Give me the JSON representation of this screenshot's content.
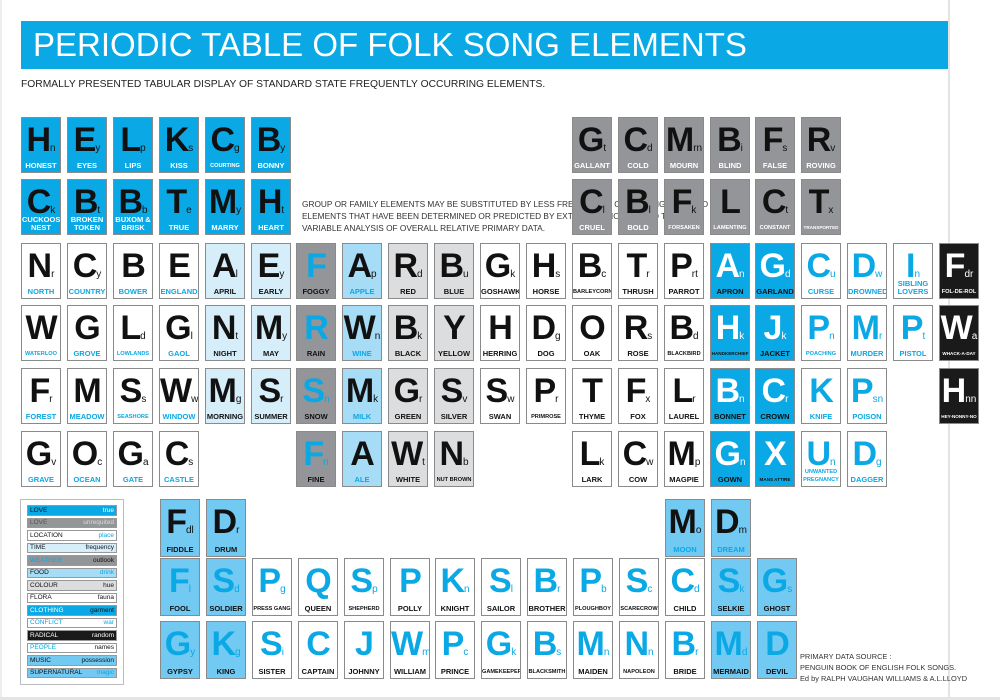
{
  "header": {
    "title": "PERIODIC TABLE OF FOLK SONG ELEMENTS",
    "subtitle": "FORMALLY PRESENTED TABULAR DISPLAY OF STANDARD STATE FREQUENTLY OCCURRING ELEMENTS."
  },
  "note": "GROUP OR FAMILY ELEMENTS MAY BE SUBSTITUTED BY LESS FREQUENTLY OCCURRING ISOLATED ELEMENTS THAT HAVE BEEN DETERMINED OR PREDICTED BY EXTRAPOLATION DUE TO THE VARIABLE ANALYSIS OF OVERALL RELATIVE PRIMARY DATA.",
  "source": {
    "line1": "PRIMARY DATA SOURCE :",
    "line2": "PENGUIN BOOK OF ENGLISH FOLK SONGS.",
    "line3": "Ed by RALPH VAUGHAN WILLIAMS & A.L.LLOYD"
  },
  "legend": [
    {
      "category": "LOVE",
      "subcategory": "true",
      "theme": "blue"
    },
    {
      "category": "LOVE",
      "subcategory": "unrequited",
      "theme": "grey"
    },
    {
      "category": "LOCATION",
      "subcategory": "place",
      "theme": "white"
    },
    {
      "category": "TIME",
      "subcategory": "frequency",
      "theme": "pale"
    },
    {
      "category": "WEATHER",
      "subcategory": "outlook",
      "theme": "dgrey"
    },
    {
      "category": "FOOD",
      "subcategory": "drink",
      "theme": "lblue"
    },
    {
      "category": "COLOUR",
      "subcategory": "hue",
      "theme": "lgrey"
    },
    {
      "category": "FLORA",
      "subcategory": "fauna",
      "theme": "whitek"
    },
    {
      "category": "CLOTHING",
      "subcategory": "garment",
      "theme": "bluew"
    },
    {
      "category": "CONFLICT",
      "subcategory": "war",
      "theme": "whiteb"
    },
    {
      "category": "RADICAL",
      "subcategory": "random",
      "theme": "black"
    },
    {
      "category": "PEOPLE",
      "subcategory": "names",
      "theme": "whitebk"
    },
    {
      "category": "MUSIC",
      "subcategory": "possession",
      "theme": "sky"
    },
    {
      "category": "SUPERNATURAL",
      "subcategory": "magic",
      "theme": "skym"
    }
  ],
  "elements": [
    {
      "s": "H",
      "sub": "n",
      "name": "HONEST",
      "row": 0,
      "col": 0,
      "theme": "blue"
    },
    {
      "s": "E",
      "sub": "y",
      "name": "EYES",
      "row": 0,
      "col": 1,
      "theme": "blue"
    },
    {
      "s": "L",
      "sub": "p",
      "name": "LIPS",
      "row": 0,
      "col": 2,
      "theme": "blue"
    },
    {
      "s": "K",
      "sub": "s",
      "name": "KISS",
      "row": 0,
      "col": 3,
      "theme": "blue"
    },
    {
      "s": "C",
      "sub": "g",
      "name": "COURTING",
      "row": 0,
      "col": 4,
      "theme": "blue"
    },
    {
      "s": "B",
      "sub": "y",
      "name": "BONNY",
      "row": 0,
      "col": 5,
      "theme": "blue"
    },
    {
      "s": "G",
      "sub": "t",
      "name": "GALLANT",
      "row": 0,
      "col": 12,
      "theme": "grey"
    },
    {
      "s": "C",
      "sub": "d",
      "name": "COLD",
      "row": 0,
      "col": 13,
      "theme": "grey"
    },
    {
      "s": "M",
      "sub": "rn",
      "name": "MOURN",
      "row": 0,
      "col": 14,
      "theme": "grey"
    },
    {
      "s": "B",
      "sub": "i",
      "name": "BLIND",
      "row": 0,
      "col": 15,
      "theme": "grey"
    },
    {
      "s": "F",
      "sub": "s",
      "name": "FALSE",
      "row": 0,
      "col": 16,
      "theme": "grey"
    },
    {
      "s": "R",
      "sub": "v",
      "name": "ROVING",
      "row": 0,
      "col": 17,
      "theme": "grey"
    },
    {
      "s": "C",
      "sub": "k",
      "name": "CUCKOOS NEST",
      "row": 1,
      "col": 0,
      "theme": "blue"
    },
    {
      "s": "B",
      "sub": "t",
      "name": "BROKEN TOKEN",
      "row": 1,
      "col": 1,
      "theme": "blue"
    },
    {
      "s": "B",
      "sub": "b",
      "name": "BUXOM & BRISK",
      "row": 1,
      "col": 2,
      "theme": "blue"
    },
    {
      "s": "T",
      "sub": "e",
      "name": "TRUE",
      "row": 1,
      "col": 3,
      "theme": "blue"
    },
    {
      "s": "M",
      "sub": "y",
      "name": "MARRY",
      "row": 1,
      "col": 4,
      "theme": "blue"
    },
    {
      "s": "H",
      "sub": "t",
      "name": "HEART",
      "row": 1,
      "col": 5,
      "theme": "blue"
    },
    {
      "s": "C",
      "sub": "l",
      "name": "CRUEL",
      "row": 1,
      "col": 12,
      "theme": "grey"
    },
    {
      "s": "B",
      "sub": "l",
      "name": "BOLD",
      "row": 1,
      "col": 13,
      "theme": "grey"
    },
    {
      "s": "F",
      "sub": "k",
      "name": "FORSAKEN",
      "row": 1,
      "col": 14,
      "theme": "grey"
    },
    {
      "s": "L",
      "sub": "",
      "name": "LAMENTING",
      "row": 1,
      "col": 15,
      "theme": "grey"
    },
    {
      "s": "C",
      "sub": "t",
      "name": "CONSTANT",
      "row": 1,
      "col": 16,
      "theme": "grey"
    },
    {
      "s": "T",
      "sub": "x",
      "name": "TRANSPORTED",
      "row": 1,
      "col": 17,
      "theme": "grey"
    },
    {
      "s": "N",
      "sub": "r",
      "name": "NORTH",
      "row": 2,
      "col": 0,
      "theme": "white"
    },
    {
      "s": "C",
      "sub": "y",
      "name": "COUNTRY",
      "row": 2,
      "col": 1,
      "theme": "white"
    },
    {
      "s": "B",
      "sub": "",
      "name": "BOWER",
      "row": 2,
      "col": 2,
      "theme": "white"
    },
    {
      "s": "E",
      "sub": "",
      "name": "ENGLAND",
      "row": 2,
      "col": 3,
      "theme": "white"
    },
    {
      "s": "A",
      "sub": "l",
      "name": "APRIL",
      "row": 2,
      "col": 4,
      "theme": "pale"
    },
    {
      "s": "E",
      "sub": "y",
      "name": "EARLY",
      "row": 2,
      "col": 5,
      "theme": "pale"
    },
    {
      "s": "F",
      "sub": "",
      "name": "FOGGY",
      "row": 2,
      "col": 6,
      "theme": "dgrey"
    },
    {
      "s": "A",
      "sub": "p",
      "name": "APPLE",
      "row": 2,
      "col": 7,
      "theme": "lblue"
    },
    {
      "s": "R",
      "sub": "d",
      "name": "RED",
      "row": 2,
      "col": 8,
      "theme": "lgrey"
    },
    {
      "s": "B",
      "sub": "u",
      "name": "BLUE",
      "row": 2,
      "col": 9,
      "theme": "lgrey"
    },
    {
      "s": "G",
      "sub": "k",
      "name": "GOSHAWK",
      "row": 2,
      "col": 10,
      "theme": "whitek"
    },
    {
      "s": "H",
      "sub": "s",
      "name": "HORSE",
      "row": 2,
      "col": 11,
      "theme": "whitek"
    },
    {
      "s": "B",
      "sub": "c",
      "name": "BARLEYCORN",
      "row": 2,
      "col": 12,
      "theme": "whitek"
    },
    {
      "s": "T",
      "sub": "r",
      "name": "THRUSH",
      "row": 2,
      "col": 13,
      "theme": "whitek"
    },
    {
      "s": "P",
      "sub": "rt",
      "name": "PARROT",
      "row": 2,
      "col": 14,
      "theme": "whitek"
    },
    {
      "s": "A",
      "sub": "n",
      "name": "APRON",
      "row": 2,
      "col": 15,
      "theme": "bluew"
    },
    {
      "s": "G",
      "sub": "d",
      "name": "GARLAND",
      "row": 2,
      "col": 16,
      "theme": "bluew"
    },
    {
      "s": "C",
      "sub": "u",
      "name": "CURSE",
      "row": 2,
      "col": 17,
      "theme": "whiteb"
    },
    {
      "s": "D",
      "sub": "w",
      "name": "DROWNED",
      "row": 2,
      "col": 18,
      "theme": "whiteb"
    },
    {
      "s": "I",
      "sub": "n",
      "name": "SIBLING LOVERS",
      "row": 2,
      "col": 19,
      "theme": "whiteb"
    },
    {
      "s": "F",
      "sub": "dr",
      "name": "FOL-DE-ROL",
      "row": 2,
      "col": 20,
      "theme": "black"
    },
    {
      "s": "W",
      "sub": "",
      "name": "WATERLOO",
      "row": 3,
      "col": 0,
      "theme": "white"
    },
    {
      "s": "G",
      "sub": "",
      "name": "GROVE",
      "row": 3,
      "col": 1,
      "theme": "white"
    },
    {
      "s": "L",
      "sub": "d",
      "name": "LOWLANDS",
      "row": 3,
      "col": 2,
      "theme": "white"
    },
    {
      "s": "G",
      "sub": "l",
      "name": "GAOL",
      "row": 3,
      "col": 3,
      "theme": "white"
    },
    {
      "s": "N",
      "sub": "t",
      "name": "NIGHT",
      "row": 3,
      "col": 4,
      "theme": "pale"
    },
    {
      "s": "M",
      "sub": "y",
      "name": "MAY",
      "row": 3,
      "col": 5,
      "theme": "pale"
    },
    {
      "s": "R",
      "sub": "",
      "name": "RAIN",
      "row": 3,
      "col": 6,
      "theme": "dgrey"
    },
    {
      "s": "W",
      "sub": "n",
      "name": "WINE",
      "row": 3,
      "col": 7,
      "theme": "lblue"
    },
    {
      "s": "B",
      "sub": "k",
      "name": "BLACK",
      "row": 3,
      "col": 8,
      "theme": "lgrey"
    },
    {
      "s": "Y",
      "sub": "",
      "name": "YELLOW",
      "row": 3,
      "col": 9,
      "theme": "lgrey"
    },
    {
      "s": "H",
      "sub": "",
      "name": "HERRING",
      "row": 3,
      "col": 10,
      "theme": "whitek"
    },
    {
      "s": "D",
      "sub": "g",
      "name": "DOG",
      "row": 3,
      "col": 11,
      "theme": "whitek"
    },
    {
      "s": "O",
      "sub": "",
      "name": "OAK",
      "row": 3,
      "col": 12,
      "theme": "whitek"
    },
    {
      "s": "R",
      "sub": "s",
      "name": "ROSE",
      "row": 3,
      "col": 13,
      "theme": "whitek"
    },
    {
      "s": "B",
      "sub": "d",
      "name": "BLACKBIRD",
      "row": 3,
      "col": 14,
      "theme": "whitek"
    },
    {
      "s": "H",
      "sub": "k",
      "name": "HANDKERCHIEF",
      "row": 3,
      "col": 15,
      "theme": "bluew"
    },
    {
      "s": "J",
      "sub": "k",
      "name": "JACKET",
      "row": 3,
      "col": 16,
      "theme": "bluew"
    },
    {
      "s": "P",
      "sub": "n",
      "name": "POACHING",
      "row": 3,
      "col": 17,
      "theme": "whiteb"
    },
    {
      "s": "M",
      "sub": "r",
      "name": "MURDER",
      "row": 3,
      "col": 18,
      "theme": "whiteb"
    },
    {
      "s": "P",
      "sub": "t",
      "name": "PISTOL",
      "row": 3,
      "col": 19,
      "theme": "whiteb"
    },
    {
      "s": "W",
      "sub": "a",
      "name": "WHACK-A-DAY",
      "row": 3,
      "col": 20,
      "theme": "black"
    },
    {
      "s": "F",
      "sub": "r",
      "name": "FOREST",
      "row": 4,
      "col": 0,
      "theme": "white"
    },
    {
      "s": "M",
      "sub": "",
      "name": "MEADOW",
      "row": 4,
      "col": 1,
      "theme": "white"
    },
    {
      "s": "S",
      "sub": "s",
      "name": "SEASHORE",
      "row": 4,
      "col": 2,
      "theme": "white"
    },
    {
      "s": "W",
      "sub": "w",
      "name": "WINDOW",
      "row": 4,
      "col": 3,
      "theme": "white"
    },
    {
      "s": "M",
      "sub": "g",
      "name": "MORNING",
      "row": 4,
      "col": 4,
      "theme": "pale"
    },
    {
      "s": "S",
      "sub": "r",
      "name": "SUMMER",
      "row": 4,
      "col": 5,
      "theme": "pale"
    },
    {
      "s": "S",
      "sub": "n",
      "name": "SNOW",
      "row": 4,
      "col": 6,
      "theme": "dgrey"
    },
    {
      "s": "M",
      "sub": "k",
      "name": "MILK",
      "row": 4,
      "col": 7,
      "theme": "lblue"
    },
    {
      "s": "G",
      "sub": "r",
      "name": "GREEN",
      "row": 4,
      "col": 8,
      "theme": "lgrey"
    },
    {
      "s": "S",
      "sub": "v",
      "name": "SILVER",
      "row": 4,
      "col": 9,
      "theme": "lgrey"
    },
    {
      "s": "S",
      "sub": "w",
      "name": "SWAN",
      "row": 4,
      "col": 10,
      "theme": "whitek"
    },
    {
      "s": "P",
      "sub": "r",
      "name": "PRIMROSE",
      "row": 4,
      "col": 11,
      "theme": "whitek"
    },
    {
      "s": "T",
      "sub": "",
      "name": "THYME",
      "row": 4,
      "col": 12,
      "theme": "whitek"
    },
    {
      "s": "F",
      "sub": "x",
      "name": "FOX",
      "row": 4,
      "col": 13,
      "theme": "whitek"
    },
    {
      "s": "L",
      "sub": "r",
      "name": "LAUREL",
      "row": 4,
      "col": 14,
      "theme": "whitek"
    },
    {
      "s": "B",
      "sub": "n",
      "name": "BONNET",
      "row": 4,
      "col": 15,
      "theme": "bluew"
    },
    {
      "s": "C",
      "sub": "r",
      "name": "CROWN",
      "row": 4,
      "col": 16,
      "theme": "bluew"
    },
    {
      "s": "K",
      "sub": "",
      "name": "KNIFE",
      "row": 4,
      "col": 17,
      "theme": "whiteb"
    },
    {
      "s": "P",
      "sub": "sn",
      "name": "POISON",
      "row": 4,
      "col": 18,
      "theme": "whiteb"
    },
    {
      "s": "H",
      "sub": "nn",
      "name": "HEY-NONNY-NO",
      "row": 4,
      "col": 20,
      "theme": "black"
    },
    {
      "s": "G",
      "sub": "v",
      "name": "GRAVE",
      "row": 5,
      "col": 0,
      "theme": "white"
    },
    {
      "s": "O",
      "sub": "c",
      "name": "OCEAN",
      "row": 5,
      "col": 1,
      "theme": "white"
    },
    {
      "s": "G",
      "sub": "a",
      "name": "GATE",
      "row": 5,
      "col": 2,
      "theme": "white"
    },
    {
      "s": "C",
      "sub": "s",
      "name": "CASTLE",
      "row": 5,
      "col": 3,
      "theme": "white"
    },
    {
      "s": "F",
      "sub": "n",
      "name": "FINE",
      "row": 5,
      "col": 6,
      "theme": "dgrey"
    },
    {
      "s": "A",
      "sub": "",
      "name": "ALE",
      "row": 5,
      "col": 7,
      "theme": "lblue"
    },
    {
      "s": "W",
      "sub": "t",
      "name": "WHITE",
      "row": 5,
      "col": 8,
      "theme": "lgrey"
    },
    {
      "s": "N",
      "sub": "b",
      "name": "NUT BROWN",
      "row": 5,
      "col": 9,
      "theme": "lgrey"
    },
    {
      "s": "L",
      "sub": "k",
      "name": "LARK",
      "row": 5,
      "col": 12,
      "theme": "whitek"
    },
    {
      "s": "C",
      "sub": "w",
      "name": "COW",
      "row": 5,
      "col": 13,
      "theme": "whitek"
    },
    {
      "s": "M",
      "sub": "p",
      "name": "MAGPIE",
      "row": 5,
      "col": 14,
      "theme": "whitek"
    },
    {
      "s": "G",
      "sub": "n",
      "name": "GOWN",
      "row": 5,
      "col": 15,
      "theme": "bluew"
    },
    {
      "s": "X",
      "sub": "",
      "name": "MANS ATTIRE",
      "row": 5,
      "col": 16,
      "theme": "bluew"
    },
    {
      "s": "U",
      "sub": "n",
      "name": "UNWANTED PREGNANCY",
      "row": 5,
      "col": 17,
      "theme": "whiteb"
    },
    {
      "s": "D",
      "sub": "g",
      "name": "DAGGER",
      "row": 5,
      "col": 18,
      "theme": "whiteb"
    },
    {
      "s": "F",
      "sub": "dl",
      "name": "FIDDLE",
      "row": 6,
      "col": 4,
      "theme": "sky"
    },
    {
      "s": "D",
      "sub": "r",
      "name": "DRUM",
      "row": 6,
      "col": 5,
      "theme": "sky"
    },
    {
      "s": "M",
      "sub": "o",
      "name": "MOON",
      "row": 6,
      "col": 15,
      "theme": "skym"
    },
    {
      "s": "D",
      "sub": "m",
      "name": "DREAM",
      "row": 6,
      "col": 16,
      "theme": "skym"
    },
    {
      "s": "F",
      "sub": "l",
      "name": "FOOL",
      "row": 7,
      "col": 4,
      "theme": "skyb"
    },
    {
      "s": "S",
      "sub": "d",
      "name": "SOLDIER",
      "row": 7,
      "col": 5,
      "theme": "skyb"
    },
    {
      "s": "P",
      "sub": "g",
      "name": "PRESS GANG",
      "row": 7,
      "col": 6,
      "theme": "whitebk"
    },
    {
      "s": "Q",
      "sub": "",
      "name": "QUEEN",
      "row": 7,
      "col": 7,
      "theme": "whitebk"
    },
    {
      "s": "S",
      "sub": "p",
      "name": "SHEPHERD",
      "row": 7,
      "col": 8,
      "theme": "whitebk"
    },
    {
      "s": "P",
      "sub": "",
      "name": "POLLY",
      "row": 7,
      "col": 9,
      "theme": "whitebk"
    },
    {
      "s": "K",
      "sub": "n",
      "name": "KNIGHT",
      "row": 7,
      "col": 10,
      "theme": "whitebk"
    },
    {
      "s": "S",
      "sub": "l",
      "name": "SAILOR",
      "row": 7,
      "col": 11,
      "theme": "whitebk"
    },
    {
      "s": "B",
      "sub": "r",
      "name": "BROTHER",
      "row": 7,
      "col": 12,
      "theme": "whitebk"
    },
    {
      "s": "P",
      "sub": "b",
      "name": "PLOUGHBOY",
      "row": 7,
      "col": 13,
      "theme": "whitebk"
    },
    {
      "s": "S",
      "sub": "c",
      "name": "SCARECROW",
      "row": 7,
      "col": 14,
      "theme": "whitebk"
    },
    {
      "s": "C",
      "sub": "d",
      "name": "CHILD",
      "row": 7,
      "col": 15,
      "theme": "whitebk"
    },
    {
      "s": "S",
      "sub": "k",
      "name": "SELKIE",
      "row": 7,
      "col": 16,
      "theme": "skyb"
    },
    {
      "s": "G",
      "sub": "s",
      "name": "GHOST",
      "row": 7,
      "col": 17,
      "theme": "skyb"
    },
    {
      "s": "G",
      "sub": "y",
      "name": "GYPSY",
      "row": 8,
      "col": 4,
      "theme": "skyb"
    },
    {
      "s": "K",
      "sub": "g",
      "name": "KING",
      "row": 8,
      "col": 5,
      "theme": "skyb"
    },
    {
      "s": "S",
      "sub": "i",
      "name": "SISTER",
      "row": 8,
      "col": 6,
      "theme": "whitebk"
    },
    {
      "s": "C",
      "sub": "",
      "name": "CAPTAIN",
      "row": 8,
      "col": 7,
      "theme": "whitebk"
    },
    {
      "s": "J",
      "sub": "",
      "name": "JOHNNY",
      "row": 8,
      "col": 8,
      "theme": "whitebk"
    },
    {
      "s": "W",
      "sub": "m",
      "name": "WILLIAM",
      "row": 8,
      "col": 9,
      "theme": "whitebk"
    },
    {
      "s": "P",
      "sub": "c",
      "name": "PRINCE",
      "row": 8,
      "col": 10,
      "theme": "whitebk"
    },
    {
      "s": "G",
      "sub": "k",
      "name": "GAMEKEEPER",
      "row": 8,
      "col": 11,
      "theme": "whitebk"
    },
    {
      "s": "B",
      "sub": "s",
      "name": "BLACKSMITH",
      "row": 8,
      "col": 12,
      "theme": "whitebk"
    },
    {
      "s": "M",
      "sub": "n",
      "name": "MAIDEN",
      "row": 8,
      "col": 13,
      "theme": "whitebk"
    },
    {
      "s": "N",
      "sub": "n",
      "name": "NAPOLEON",
      "row": 8,
      "col": 14,
      "theme": "whitebk"
    },
    {
      "s": "B",
      "sub": "r",
      "name": "BRIDE",
      "row": 8,
      "col": 15,
      "theme": "whitebk"
    },
    {
      "s": "M",
      "sub": "d",
      "name": "MERMAID",
      "row": 8,
      "col": 16,
      "theme": "skyb"
    },
    {
      "s": "D",
      "sub": "",
      "name": "DEVIL",
      "row": 8,
      "col": 17,
      "theme": "skyb"
    }
  ]
}
